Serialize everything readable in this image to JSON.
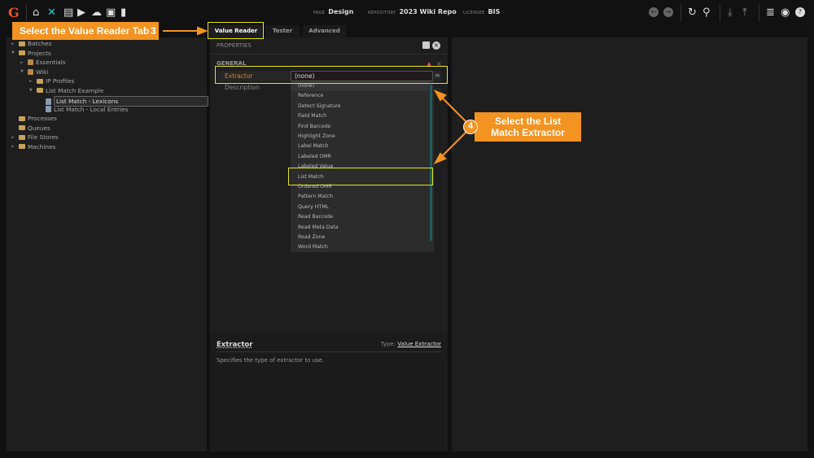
{
  "header": {
    "logo": "G",
    "page_label": "PAGE",
    "page": "Design",
    "repo_label": "REPOSITORY",
    "repo": "2023 Wiki Repo",
    "licensee_label": "LICENSEE",
    "licensee": "BIS"
  },
  "tabs": [
    "Value Reader",
    "Tester",
    "Advanced"
  ],
  "tree": [
    {
      "label": "Batches",
      "depth": 1,
      "icon": "folder",
      "caret": "right"
    },
    {
      "label": "Projects",
      "depth": 1,
      "icon": "folder",
      "caret": "down"
    },
    {
      "label": "Essentials",
      "depth": 2,
      "icon": "package",
      "caret": "right"
    },
    {
      "label": "Wiki",
      "depth": 2,
      "icon": "package",
      "caret": "down"
    },
    {
      "label": "IP Profiles",
      "depth": 3,
      "icon": "folder",
      "caret": "right"
    },
    {
      "label": "List Match Example",
      "depth": 3,
      "icon": "folder",
      "caret": "down"
    },
    {
      "label": "List Match - Lexicons",
      "depth": 4,
      "icon": "doc",
      "selected": true
    },
    {
      "label": "List Match - Local Entries",
      "depth": 4,
      "icon": "doc"
    },
    {
      "label": "Processes",
      "depth": 1,
      "icon": "folder"
    },
    {
      "label": "Queues",
      "depth": 1,
      "icon": "folder"
    },
    {
      "label": "File Stores",
      "depth": 1,
      "icon": "folder",
      "caret": "right"
    },
    {
      "label": "Machines",
      "depth": 1,
      "icon": "folder",
      "caret": "right"
    }
  ],
  "properties": {
    "title": "PROPERTIES",
    "section": "GENERAL",
    "extractor_label": "Extractor",
    "extractor_value": "(none)",
    "description_label": "Description"
  },
  "dropdown": [
    "(none)",
    "Reference",
    "Detect Signature",
    "Field Match",
    "Find Barcode",
    "Highlight Zone",
    "Label Match",
    "Labeled OMR",
    "Labeled Value",
    "List Match",
    "Ordered OMR",
    "Pattern Match",
    "Query HTML",
    "Read Barcode",
    "Read Meta Data",
    "Read Zone",
    "Word Match"
  ],
  "help": {
    "title": "Extractor",
    "type_label": "Type:",
    "type_value": "Value Extractor",
    "text": "Specifies the type of extractor to use."
  },
  "callouts": {
    "c3": "Select the Value Reader Tab",
    "n3": "3",
    "c4": "Select the List Match Extractor",
    "n4": "4"
  },
  "colors": {
    "accent": "#f39322",
    "highlight": "#e6e61e",
    "label_orange": "#d9822b"
  }
}
